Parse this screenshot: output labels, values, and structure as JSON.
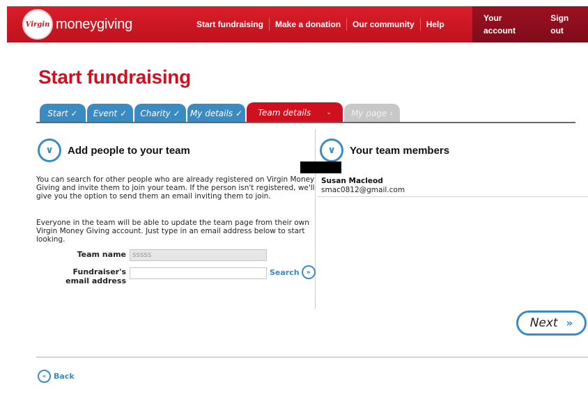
{
  "header": {
    "logo_mark": "Virgin",
    "logo_text": "moneygiving",
    "nav": [
      "Start fundraising",
      "Make a donation",
      "Our community",
      "Help"
    ],
    "account_nav": [
      "Your account",
      "Sign out"
    ]
  },
  "page_title": "Start fundraising",
  "tabs": [
    {
      "label": "Start ✓",
      "state": "done"
    },
    {
      "label": "Event ✓",
      "state": "done"
    },
    {
      "label": "Charity ✓",
      "state": "done"
    },
    {
      "label": "My details ✓",
      "state": "done"
    },
    {
      "label": "Team details",
      "state": "active"
    },
    {
      "label": "My page ›",
      "state": "future"
    }
  ],
  "left": {
    "heading": "Add people to your team",
    "para1": "You can search for other people who are already registered on Virgin Money Giving and invite them to join your team. If the person isn't registered, we'll give you the option to send them an email inviting them to join.",
    "para2": "Everyone in the team will be able to update the team page from their own Virgin Money Giving account. Just type in an email address below to start looking.",
    "team_name_label": "Team name",
    "team_name_value": "sssss",
    "email_label": "Fundraiser's email address",
    "email_value": "",
    "search_label": "Search"
  },
  "right": {
    "heading": "Your team members",
    "members": [
      {
        "name": "Susan Macleod",
        "email": "smac0812@gmail.com"
      }
    ]
  },
  "next_label": "Next",
  "back_label": "Back",
  "colors": {
    "brand_red": "#d0101e",
    "accent_blue": "#3a8bc2",
    "account_bar": "#8a0e1e"
  }
}
